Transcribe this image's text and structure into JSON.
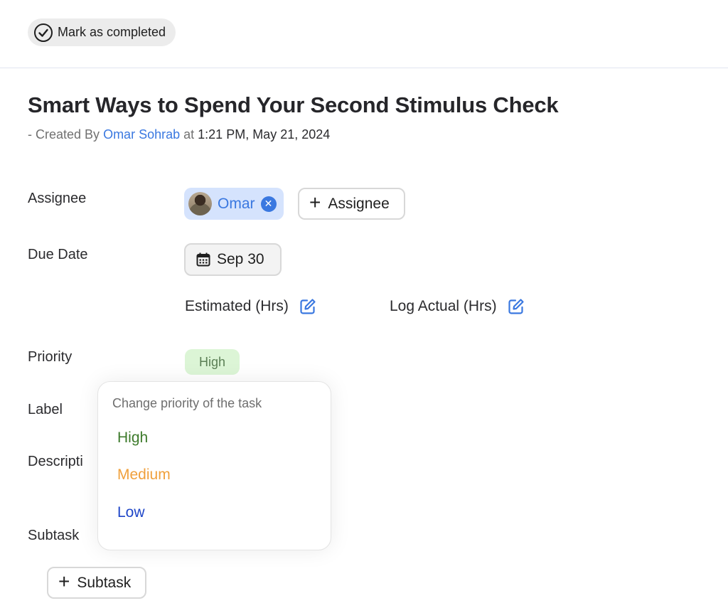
{
  "toolbar": {
    "mark_completed_label": "Mark as completed",
    "mark_completed_icon": "check-circle-icon"
  },
  "task": {
    "title": "Smart Ways to Spend Your Second Stimulus Check",
    "created_prefix": "- Created By",
    "author": "Omar Sohrab",
    "at_word": "at",
    "created_time": "1:21 PM, May 21, 2024"
  },
  "fields": {
    "assignee_label": "Assignee",
    "due_date_label": "Due Date",
    "priority_label": "Priority",
    "label_label": "Label",
    "description_label": "Descripti",
    "subtask_label": "Subtask"
  },
  "assignee": {
    "chips": [
      {
        "name": "Omar",
        "avatar": "avatar-photo",
        "remove_icon": "close-circle-icon"
      }
    ],
    "add_label": "Assignee",
    "add_icon": "plus-icon"
  },
  "due_date": {
    "value": "Sep 30",
    "icon": "calendar-icon"
  },
  "hours": {
    "estimated_label": "Estimated (Hrs)",
    "actual_label": "Log Actual (Hrs)",
    "edit_icon": "edit-icon"
  },
  "priority": {
    "current": "High",
    "badge_bg": "#dcf5d6",
    "badge_fg": "#5b7f55"
  },
  "priority_menu": {
    "heading": "Change priority of the task",
    "options": [
      {
        "label": "High",
        "color": "#3d7a2b"
      },
      {
        "label": "Medium",
        "color": "#f0a03c"
      },
      {
        "label": "Low",
        "color": "#1f46c8"
      }
    ]
  },
  "subtask": {
    "add_label": "Subtask",
    "add_icon": "plus-icon"
  },
  "colors": {
    "accent": "#3a78e0",
    "chip_bg": "#d5e3fd",
    "divider": "#e1e5f0"
  }
}
